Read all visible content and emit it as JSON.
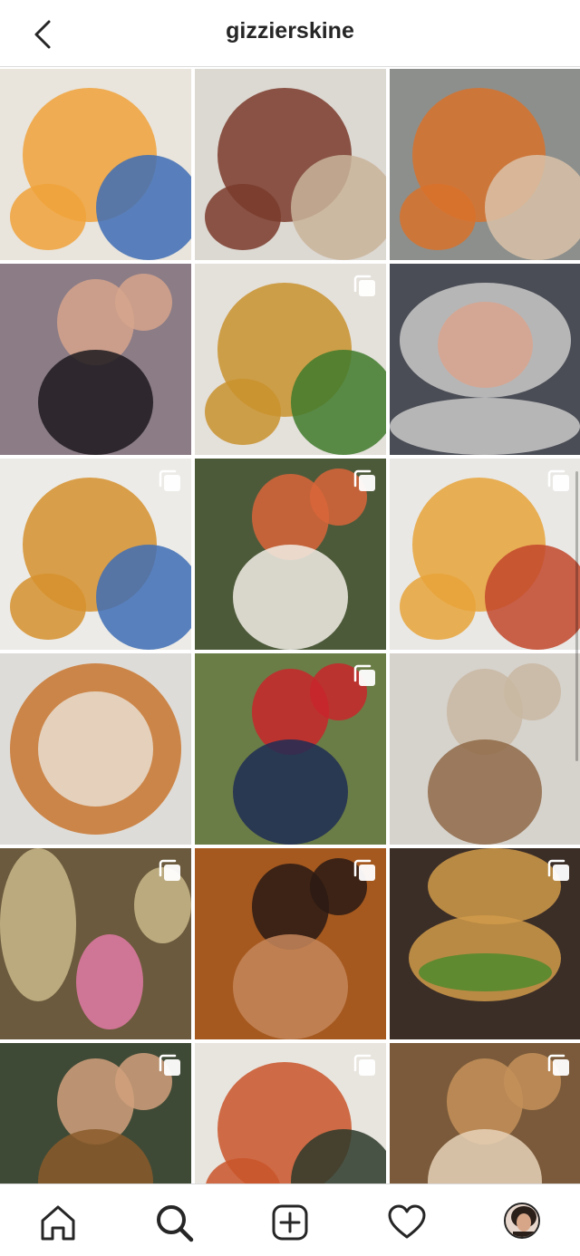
{
  "header": {
    "username": "gizzierskine",
    "back_icon": "chevron-left-icon"
  },
  "grid": {
    "tiles": [
      {
        "subject": "food",
        "multi": false,
        "bg": "#e9e4dc",
        "c1": "#f0a23a",
        "c2": "#3e6db5"
      },
      {
        "subject": "food",
        "multi": false,
        "bg": "#dcd8d2",
        "c1": "#7a3b2b",
        "c2": "#c9b49a"
      },
      {
        "subject": "food",
        "multi": false,
        "bg": "#8d8f8c",
        "c1": "#d8722c",
        "c2": "#d9c2a8"
      },
      {
        "subject": "portrait",
        "multi": false,
        "bg": "#8b7c86",
        "c1": "#1d1a1f",
        "c2": "#d6a58c"
      },
      {
        "subject": "food",
        "multi": true,
        "bg": "#e4e0da",
        "c1": "#c9922e",
        "c2": "#3f7a2c"
      },
      {
        "subject": "laptop",
        "multi": false,
        "bg": "#4a4d55",
        "c1": "#c9c9c9",
        "c2": "#d9a48e"
      },
      {
        "subject": "food",
        "multi": true,
        "bg": "#ecebe7",
        "c1": "#d6902d",
        "c2": "#3e6db5"
      },
      {
        "subject": "portrait",
        "multi": true,
        "bg": "#4d5a3a",
        "c1": "#f2ede6",
        "c2": "#d9653a"
      },
      {
        "subject": "food",
        "multi": true,
        "bg": "#e9e8e5",
        "c1": "#e8a33a",
        "c2": "#c2462c"
      },
      {
        "subject": "pizza",
        "multi": false,
        "bg": "#dedcd8",
        "c1": "#c9762f",
        "c2": "#e8ddd0"
      },
      {
        "subject": "portrait",
        "multi": true,
        "bg": "#6b7d46",
        "c1": "#1f2d55",
        "c2": "#c8262c"
      },
      {
        "subject": "portrait",
        "multi": false,
        "bg": "#d6d2cc",
        "c1": "#8f6a48",
        "c2": "#c9b9a2"
      },
      {
        "subject": "pub",
        "multi": true,
        "bg": "#6b5a3d",
        "c1": "#e07aa5",
        "c2": "#c9b98a"
      },
      {
        "subject": "portrait",
        "multi": true,
        "bg": "#a5591f",
        "c1": "#c4865a",
        "c2": "#2a1a14"
      },
      {
        "subject": "burger",
        "multi": true,
        "bg": "#3b2e27",
        "c1": "#d09a4a",
        "c2": "#4f8a2c"
      },
      {
        "subject": "portrait",
        "multi": true,
        "bg": "#3f4a36",
        "c1": "#8a5a2a",
        "c2": "#d1a07d"
      },
      {
        "subject": "food",
        "multi": true,
        "bg": "#e8e4de",
        "c1": "#c9552a",
        "c2": "#2d3a2a"
      },
      {
        "subject": "portrait",
        "multi": true,
        "bg": "#7a5a3a",
        "c1": "#e6d2b8",
        "c2": "#c4905a"
      },
      {
        "subject": "partial",
        "multi": false,
        "bg": "#6a5540",
        "c1": "#c98f4a",
        "c2": "#3a2d22"
      },
      {
        "subject": "partial",
        "multi": false,
        "bg": "#b39a7a",
        "c1": "#d8c2a0",
        "c2": "#5a4a3a"
      },
      {
        "subject": "partial",
        "multi": false,
        "bg": "#3a3236",
        "c1": "#b487a0",
        "c2": "#1e1a1c"
      }
    ],
    "multi_icon": "multiple-posts-icon"
  },
  "bottom_nav": {
    "items": [
      {
        "name": "home",
        "icon": "home-icon"
      },
      {
        "name": "search",
        "icon": "search-icon",
        "active": true
      },
      {
        "name": "create",
        "icon": "plus-square-icon"
      },
      {
        "name": "activity",
        "icon": "heart-icon"
      },
      {
        "name": "profile",
        "icon": "avatar"
      }
    ]
  },
  "colors": {
    "text": "#262626",
    "divider": "#dbdbdb",
    "background": "#ffffff"
  }
}
